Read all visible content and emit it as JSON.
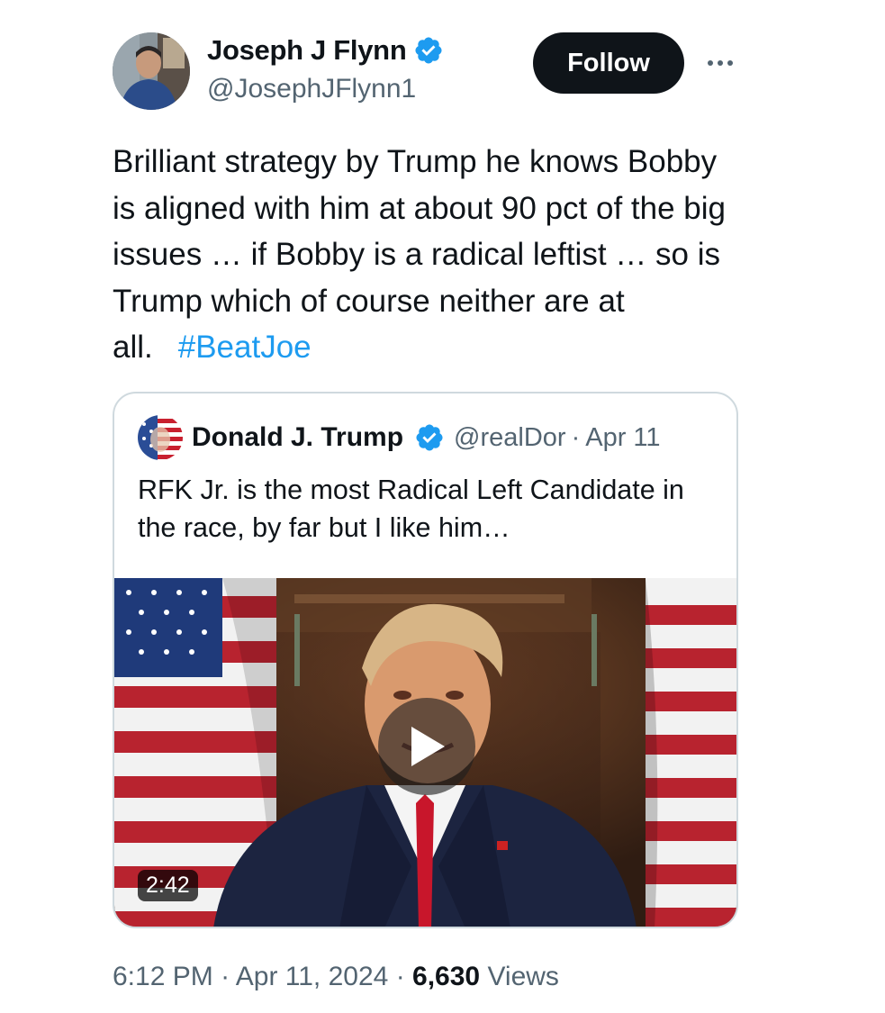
{
  "author": {
    "name": "Joseph J Flynn",
    "handle": "@JosephJFlynn1",
    "verified": true,
    "avatar_icon": "avatar-photo"
  },
  "actions": {
    "follow_label": "Follow",
    "more_icon": "more-horizontal-icon"
  },
  "tweet": {
    "text": "Brilliant strategy by Trump he knows Bobby is aligned with him at about 90 pct of the big issues … if Bobby is a radical leftist … so is Trump which of course neither are at all.",
    "hashtag": "#BeatJoe"
  },
  "quoted_tweet": {
    "author_name": "Donald J. Trump",
    "handle": "@realDor",
    "separator": "·",
    "date": "Apr 11",
    "text": "RFK Jr. is the most Radical Left Candidate in the race, by far but I like him…",
    "verified": true,
    "video": {
      "duration": "2:42",
      "play_icon": "play-icon"
    }
  },
  "meta": {
    "time": "6:12 PM",
    "separator": "·",
    "date": "Apr 11, 2024",
    "views_count": "6,630",
    "views_label": "Views"
  },
  "colors": {
    "link": "#1d9bf0",
    "text": "#0f1419",
    "secondary": "#536471",
    "follow_bg": "#0f1419",
    "border": "#cfd9de"
  }
}
